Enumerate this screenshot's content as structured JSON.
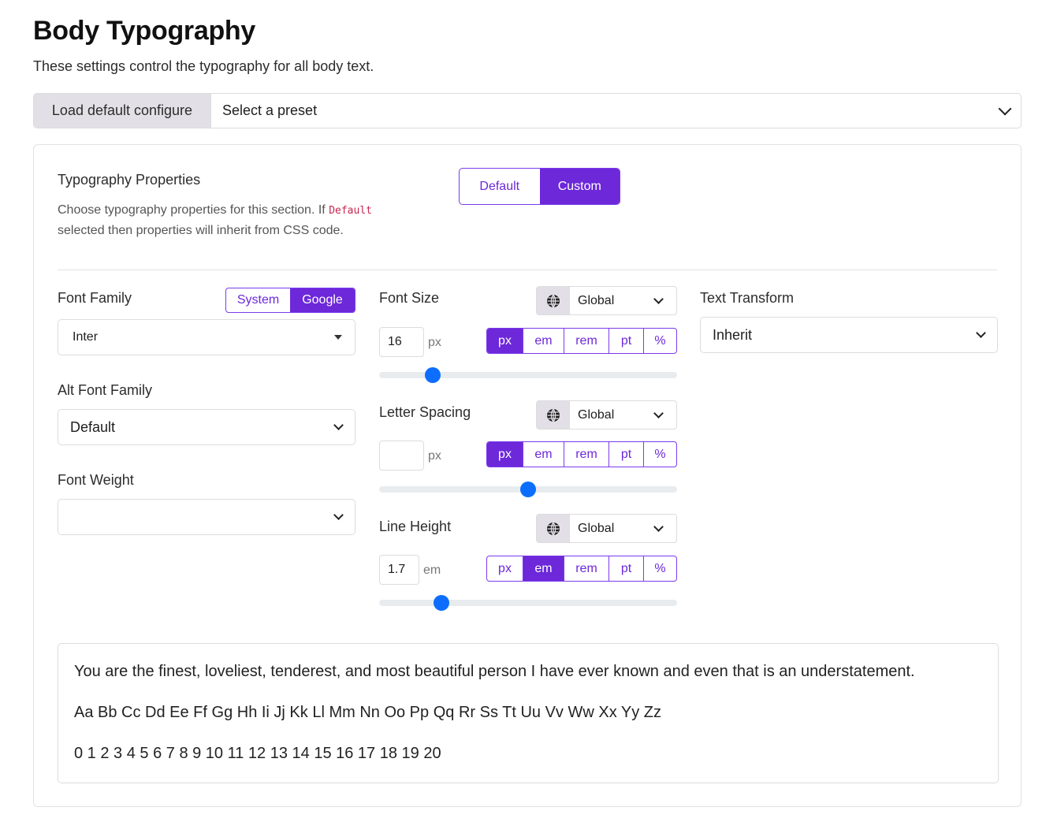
{
  "header": {
    "title": "Body Typography",
    "subtitle": "These settings control the typography for all body text."
  },
  "preset": {
    "load_label": "Load default configure",
    "selected": "Select a preset"
  },
  "properties": {
    "title": "Typography Properties",
    "desc_before": "Choose typography properties for this section. If ",
    "desc_code": "Default",
    "desc_after": " selected then properties will inherit from CSS code.",
    "mode_default": "Default",
    "mode_custom": "Custom",
    "active_mode": "Custom"
  },
  "font_family": {
    "label": "Font Family",
    "source_system": "System",
    "source_google": "Google",
    "active_source": "Google",
    "value": "Inter"
  },
  "alt_font_family": {
    "label": "Alt Font Family",
    "value": "Default"
  },
  "font_weight": {
    "label": "Font Weight",
    "value": ""
  },
  "font_size": {
    "label": "Font Size",
    "scope": "Global",
    "value": "16",
    "unit_display": "px",
    "units": [
      "px",
      "em",
      "rem",
      "pt",
      "%"
    ],
    "active_unit": "px",
    "slider_fraction": 0.18
  },
  "letter_spacing": {
    "label": "Letter Spacing",
    "scope": "Global",
    "value": "",
    "unit_display": "px",
    "units": [
      "px",
      "em",
      "rem",
      "pt",
      "%"
    ],
    "active_unit": "px",
    "slider_fraction": 0.5
  },
  "line_height": {
    "label": "Line Height",
    "scope": "Global",
    "value": "1.7",
    "unit_display": "em",
    "units": [
      "px",
      "em",
      "rem",
      "pt",
      "%"
    ],
    "active_unit": "em",
    "slider_fraction": 0.21
  },
  "text_transform": {
    "label": "Text Transform",
    "value": "Inherit"
  },
  "preview": {
    "sentence": "You are the finest, loveliest, tenderest, and most beautiful person I have ever known and even that is an understatement.",
    "alphabet": "Aa Bb Cc Dd Ee Ff Gg Hh Ii Jj Kk Ll Mm Nn Oo Pp Qq Rr Ss Tt Uu Vv Ww Xx Yy Zz",
    "numbers": "0 1 2 3 4 5 6 7 8 9 10 11 12 13 14 15 16 17 18 19 20"
  },
  "icons": {
    "scope": "globe-icon",
    "dropdown": "chevron-down-icon",
    "caret": "caret-down-icon"
  },
  "colors": {
    "accent": "#6d28d9",
    "slider": "#0d6efd"
  }
}
